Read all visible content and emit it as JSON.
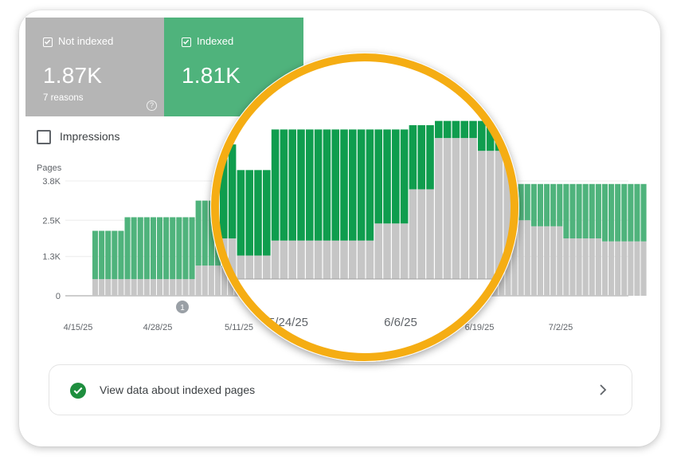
{
  "tiles": {
    "not_indexed": {
      "label": "Not indexed",
      "value": "1.87K",
      "sub": "7 reasons",
      "color": "#b5b5b5"
    },
    "indexed": {
      "label": "Indexed",
      "value": "1.81K",
      "color": "#4fb37c"
    }
  },
  "impressions": {
    "label": "Impressions",
    "checked": false
  },
  "footer": {
    "label": "View data about indexed pages"
  },
  "icons": {
    "tile_checkbox": "checkbox-checked-icon",
    "help": "help-circle-icon",
    "ok": "check-circle-icon",
    "chevron": "chevron-right-icon"
  },
  "colors": {
    "indexed": "#4fb37c",
    "not_indexed": "#c6c6c6",
    "magnifier_indexed": "#0f9d4e",
    "magnifier_ring": "#f5ad13"
  },
  "chart_data": {
    "type": "bar",
    "stacked": true,
    "ylabel": "Pages",
    "yticks": [
      "0",
      "1.3K",
      "2.5K",
      "3.8K"
    ],
    "ylim": [
      0,
      3800
    ],
    "xticks": [
      "4/15/25",
      "4/28/25",
      "5/11/25",
      "5/24/25",
      "6/6/25",
      "6/19/25",
      "7/2/25"
    ],
    "annotation": "1",
    "x": [
      "4/20",
      "4/21",
      "4/22",
      "4/23",
      "4/24",
      "4/25",
      "4/26",
      "4/27",
      "4/28",
      "4/29",
      "4/30",
      "5/1",
      "5/2",
      "5/3",
      "5/4",
      "5/5",
      "5/6",
      "5/7",
      "5/8",
      "5/9",
      "5/10",
      "5/11",
      "5/12",
      "5/13",
      "5/14",
      "5/15",
      "5/16",
      "5/17",
      "5/18",
      "5/19",
      "5/20",
      "5/21",
      "5/22",
      "5/23",
      "5/24",
      "5/25",
      "5/26",
      "5/27",
      "5/28",
      "5/29",
      "5/30",
      "5/31",
      "6/1",
      "6/2",
      "6/3",
      "6/4",
      "6/5",
      "6/6",
      "6/7",
      "6/8",
      "6/9",
      "6/10",
      "6/11",
      "6/12",
      "6/13",
      "6/14",
      "6/15",
      "6/16",
      "6/17",
      "6/18",
      "6/19",
      "6/20",
      "6/21",
      "6/22",
      "6/23",
      "6/24",
      "6/25",
      "6/26",
      "6/27",
      "6/28",
      "6/29",
      "6/30",
      "7/1",
      "7/2",
      "7/3",
      "7/4",
      "7/5",
      "7/6",
      "7/7",
      "7/8",
      "7/9",
      "7/10",
      "7/11",
      "7/12",
      "7/13",
      "7/14"
    ],
    "series": [
      {
        "name": "Not indexed",
        "values": [
          550,
          550,
          550,
          550,
          550,
          550,
          550,
          550,
          550,
          550,
          550,
          550,
          550,
          550,
          550,
          550,
          1000,
          1000,
          1000,
          1000,
          950,
          950,
          950,
          950,
          550,
          550,
          550,
          550,
          900,
          900,
          900,
          900,
          900,
          900,
          900,
          900,
          900,
          900,
          900,
          900,
          1300,
          1300,
          1300,
          1300,
          2100,
          2100,
          2100,
          3300,
          3300,
          3300,
          3300,
          3300,
          3000,
          3000,
          3000,
          3000,
          3000,
          3000,
          3000,
          2900,
          2900,
          2900,
          2900,
          2600,
          2600,
          2600,
          2500,
          2500,
          2300,
          2300,
          2300,
          2300,
          2300,
          1900,
          1900,
          1900,
          1900,
          1900,
          1900,
          1800,
          1800,
          1800,
          1800,
          1800,
          1800,
          1800
        ]
      },
      {
        "name": "Indexed",
        "values": [
          1600,
          1600,
          1600,
          1600,
          1600,
          2050,
          2050,
          2050,
          2050,
          2050,
          2050,
          2050,
          2050,
          2050,
          2050,
          2050,
          2150,
          2150,
          2150,
          2150,
          2200,
          2200,
          2200,
          2200,
          2000,
          2000,
          2000,
          2000,
          2600,
          2600,
          2600,
          2600,
          2600,
          2600,
          2600,
          2600,
          2600,
          2600,
          2600,
          2600,
          2200,
          2200,
          2200,
          2200,
          1500,
          1500,
          1500,
          400,
          400,
          400,
          400,
          400,
          700,
          700,
          700,
          700,
          700,
          700,
          700,
          800,
          800,
          800,
          800,
          1100,
          1100,
          1100,
          1200,
          1200,
          1400,
          1400,
          1400,
          1400,
          1400,
          1800,
          1800,
          1800,
          1800,
          1800,
          1800,
          1900,
          1900,
          1900,
          1900,
          1900,
          1900,
          1900
        ]
      }
    ]
  }
}
